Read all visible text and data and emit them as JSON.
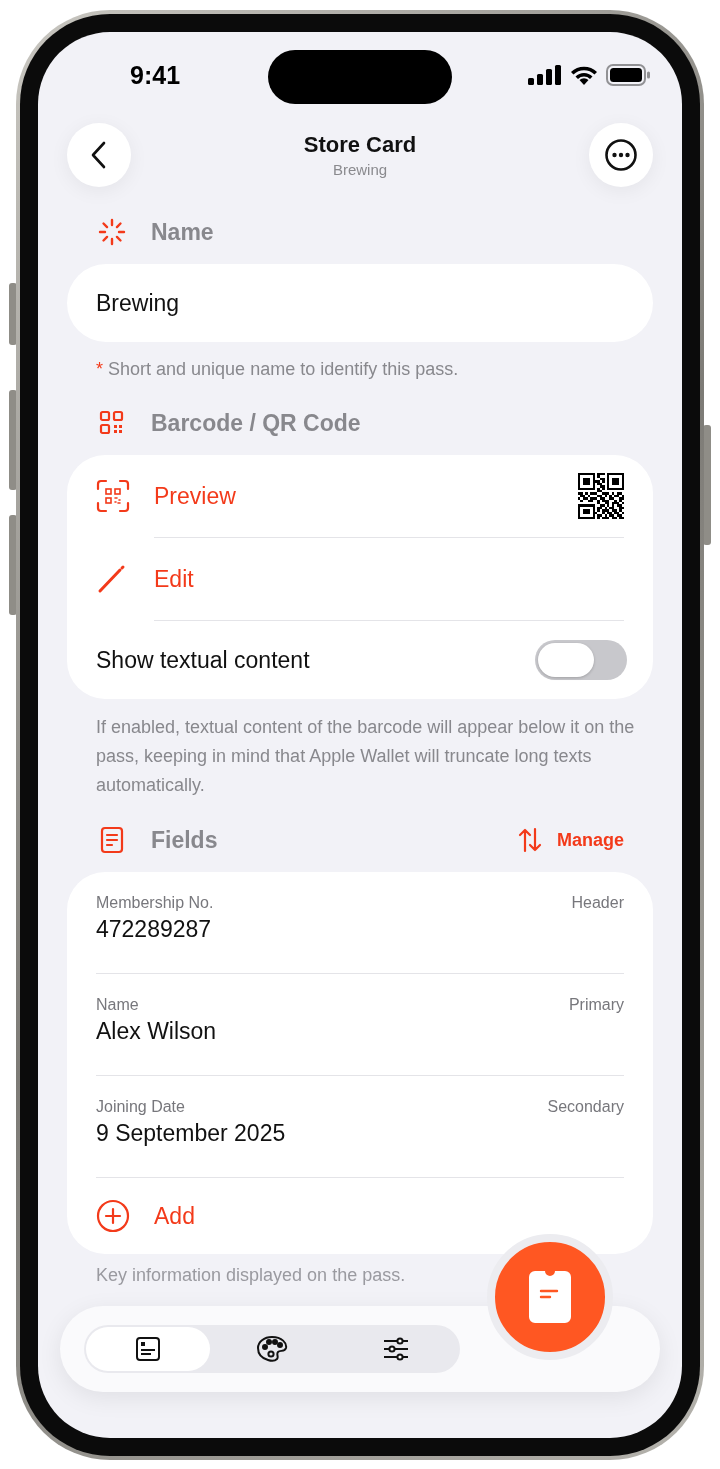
{
  "status_bar": {
    "time": "9:41"
  },
  "header": {
    "title": "Store Card",
    "subtitle": "Brewing"
  },
  "name_section": {
    "heading": "Name",
    "value": "Brewing",
    "required_mark": "*",
    "hint": "Short and unique name to identify this pass."
  },
  "barcode_section": {
    "heading": "Barcode / QR Code",
    "rows": [
      {
        "kind": "preview",
        "label": "Preview"
      },
      {
        "kind": "edit",
        "label": "Edit"
      },
      {
        "kind": "toggle",
        "label": "Show textual content",
        "on": false
      }
    ],
    "note": "If enabled, textual content of the barcode will appear below it on the pass, keeping in mind that Apple Wallet will truncate long texts automatically."
  },
  "fields_section": {
    "heading": "Fields",
    "action": "Manage",
    "fields": [
      {
        "label": "Membership No.",
        "value": "472289287",
        "type": "Header"
      },
      {
        "label": "Name",
        "value": "Alex Wilson",
        "type": "Primary"
      },
      {
        "label": "Joining Date",
        "value": "9 September 2025",
        "type": "Secondary"
      }
    ],
    "add_label": "Add",
    "note": "Key information displayed on the pass."
  },
  "tab_bar": {
    "tabs": [
      {
        "kind": "fields",
        "selected": true
      },
      {
        "kind": "design",
        "selected": false
      },
      {
        "kind": "settings",
        "selected": false
      }
    ]
  }
}
